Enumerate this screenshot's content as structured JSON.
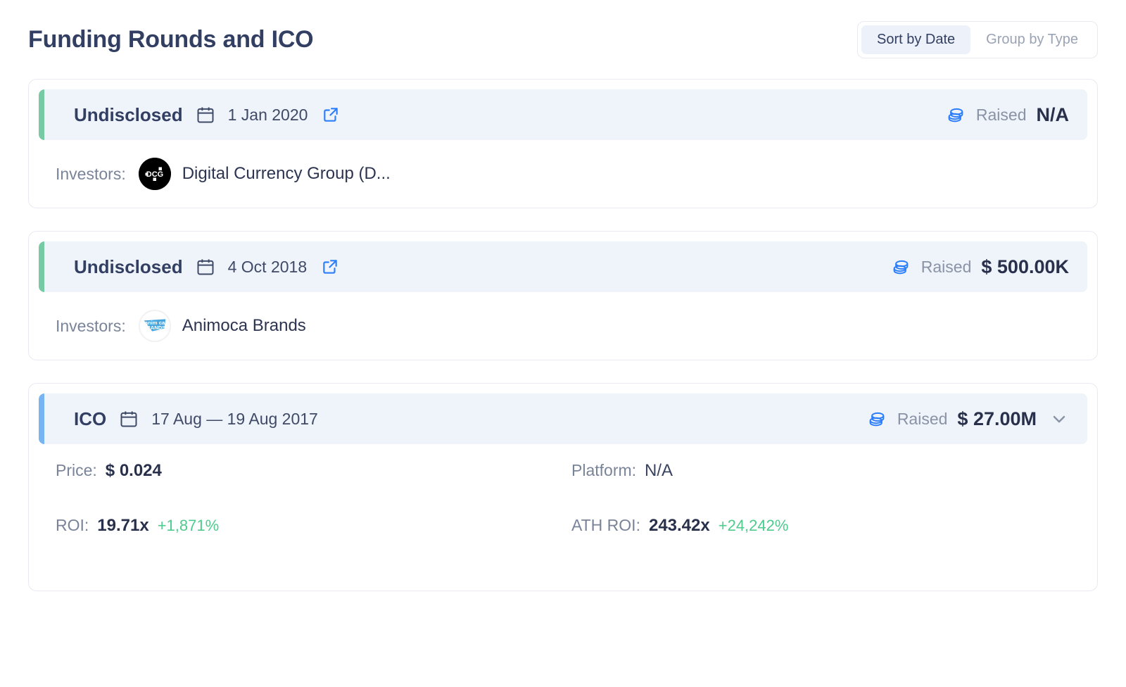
{
  "header": {
    "title": "Funding Rounds and ICO",
    "toggle": {
      "sort_by_date": "Sort by Date",
      "group_by_type": "Group by Type",
      "active": "Sort by Date"
    }
  },
  "colors": {
    "accent_green": "#76CBA4",
    "accent_blue": "#76B4F2",
    "band_bg": "#EFF3FA",
    "title": "#323F63",
    "positive": "#4ECB8D",
    "link_blue": "#2D7FF9"
  },
  "labels": {
    "investors": "Investors:",
    "raised": "Raised",
    "price": "Price:",
    "platform": "Platform:",
    "roi": "ROI:",
    "ath_roi": "ATH ROI:"
  },
  "icons": {
    "calendar": "calendar-icon",
    "external_link": "external-link-icon",
    "coins": "coins-icon",
    "chevron_down": "chevron-down-icon"
  },
  "rounds": [
    {
      "type": "Undisclosed",
      "date": "1 Jan 2020",
      "accent": "green",
      "has_external_link": true,
      "has_chevron": false,
      "raised": "N/A",
      "investors": [
        {
          "name": "Digital Currency Group (D...",
          "logo": "dcg"
        }
      ]
    },
    {
      "type": "Undisclosed",
      "date": "4 Oct 2018",
      "accent": "green",
      "has_external_link": true,
      "has_chevron": false,
      "raised": "$ 500.00K",
      "investors": [
        {
          "name": "Animoca Brands",
          "logo": "animoca"
        }
      ]
    },
    {
      "type": "ICO",
      "date": "17 Aug — 19 Aug 2017",
      "accent": "blue",
      "has_external_link": false,
      "has_chevron": true,
      "raised": "$ 27.00M",
      "details": {
        "price": "$ 0.024",
        "platform": "N/A",
        "roi_value": "19.71x",
        "roi_delta": "+1,871%",
        "ath_roi_value": "243.42x",
        "ath_roi_delta": "+24,242%"
      }
    }
  ]
}
